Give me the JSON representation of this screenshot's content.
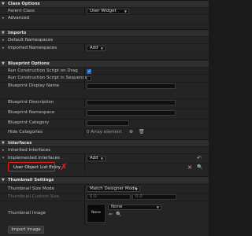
{
  "class_options": {
    "header": "Class Options",
    "parent_class_label": "Parent Class",
    "parent_class_value": "User Widget",
    "advanced_label": "Advanced"
  },
  "imports": {
    "header": "Imports",
    "default_namespaces_label": "Default Namespaces",
    "imported_namespaces_label": "Imported Namespaces",
    "add_label": "Add"
  },
  "blueprint_options": {
    "header": "Blueprint Options",
    "run_construction_on_drag_label": "Run Construction Script on Drag",
    "run_construction_on_drag_checked": true,
    "run_construction_in_sequencer_label": "Run Construction Script in Sequencer",
    "run_construction_in_sequencer_checked": false,
    "display_name_label": "Blueprint Display Name",
    "description_label": "Blueprint Description",
    "namespace_label": "Blueprint Namespace",
    "category_label": "Blueprint Category",
    "hide_categories_label": "Hide Categories",
    "hide_categories_value": "0 Array element"
  },
  "interfaces": {
    "header": "Interfaces",
    "inherited_label": "Inherited Interfaces",
    "implemented_label": "Implemented Interfaces",
    "add_label": "Add",
    "implemented_items": [
      "User Object List Entry"
    ]
  },
  "thumbnail": {
    "header": "Thumbnail Settings",
    "size_mode_label": "Thumbnail Size Mode",
    "size_mode_value": "Match Designer Mode",
    "custom_size_label": "Thumbnail Custom Size",
    "custom_size_x": "0.0",
    "custom_size_y": "0.0",
    "image_label": "Thumbnail Image",
    "image_preview_text": "None",
    "image_dropdown_value": "None",
    "import_button_label": "Import Image"
  },
  "annotation_color": "#e51d1d",
  "accent_color": "#1d6ad6"
}
